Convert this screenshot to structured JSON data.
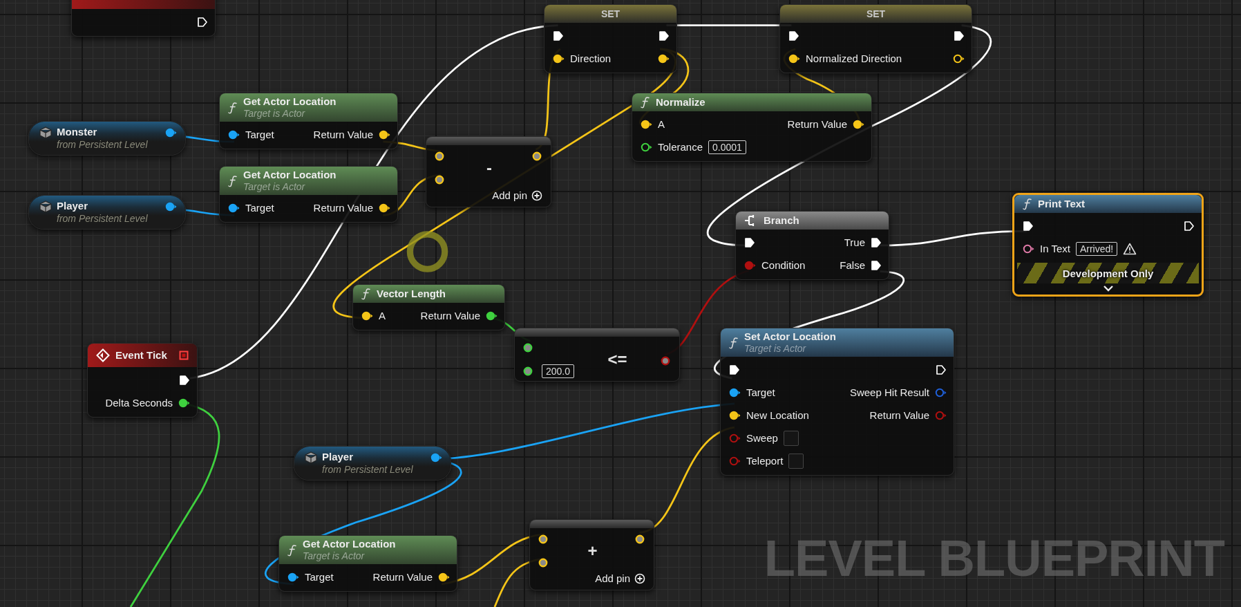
{
  "nodes": [
    {
      "kind": "event",
      "selected": false,
      "outputs": [
        {
          "kind": "exec",
          "connected": false
        }
      ]
    },
    {
      "kind": "set",
      "title": "SET",
      "selected": false,
      "inputs": [
        {
          "kind": "exec",
          "connected": true
        },
        {
          "kind": "vector",
          "label": "Direction",
          "connected": true
        }
      ],
      "outputs": [
        {
          "kind": "exec",
          "connected": true
        },
        {
          "kind": "vector",
          "connected": true
        }
      ]
    },
    {
      "kind": "set",
      "title": "SET",
      "selected": false,
      "inputs": [
        {
          "kind": "exec",
          "connected": true
        },
        {
          "kind": "vector",
          "label": "Normalized Direction",
          "connected": true
        }
      ],
      "outputs": [
        {
          "kind": "exec",
          "connected": true
        },
        {
          "kind": "vector",
          "connected": false
        }
      ]
    },
    {
      "kind": "variable",
      "title": "Monster",
      "subtitle": "from Persistent Level",
      "selected": false,
      "outputs": [
        {
          "kind": "object",
          "connected": true
        }
      ]
    },
    {
      "kind": "pure",
      "title": "Get Actor Location",
      "subtitle": "Target is Actor",
      "selected": false,
      "inputs": [
        {
          "kind": "object",
          "label": "Target",
          "connected": true
        }
      ],
      "outputs": [
        {
          "kind": "vector",
          "label": "Return Value",
          "connected": true
        }
      ]
    },
    {
      "kind": "pure",
      "title": "Get Actor Location",
      "subtitle": "Target is Actor",
      "selected": false,
      "inputs": [
        {
          "kind": "object",
          "label": "Target",
          "connected": true
        }
      ],
      "outputs": [
        {
          "kind": "vector",
          "label": "Return Value",
          "connected": true
        }
      ]
    },
    {
      "kind": "operator",
      "symbol": "-",
      "footer": "Add pin",
      "selected": false,
      "inputs": [
        {
          "kind": "vector",
          "connected": true
        },
        {
          "kind": "vector",
          "connected": true
        }
      ],
      "outputs": [
        {
          "kind": "vector",
          "connected": true
        }
      ]
    },
    {
      "kind": "variable",
      "title": "Player",
      "subtitle": "from Persistent Level",
      "selected": false,
      "outputs": [
        {
          "kind": "object",
          "connected": true
        }
      ]
    },
    {
      "kind": "pure",
      "title": "Normalize",
      "selected": false,
      "inputs": [
        {
          "kind": "vector",
          "label": "A",
          "connected": true
        },
        {
          "kind": "float",
          "label": "Tolerance",
          "connected": false,
          "value": "0.0001"
        }
      ],
      "outputs": [
        {
          "kind": "vector",
          "label": "Return Value",
          "connected": true
        }
      ]
    },
    {
      "kind": "branch",
      "title": "Branch",
      "selected": false,
      "inputs": [
        {
          "kind": "exec",
          "connected": true
        },
        {
          "kind": "bool",
          "label": "Condition",
          "connected": true
        }
      ],
      "outputs": [
        {
          "kind": "exec",
          "label": "True",
          "connected": true
        },
        {
          "kind": "exec",
          "label": "False",
          "connected": true
        }
      ]
    },
    {
      "kind": "function",
      "title": "Print Text",
      "selected": true,
      "inputs": [
        {
          "kind": "exec",
          "connected": true
        },
        {
          "kind": "text",
          "label": "In Text",
          "connected": false,
          "value": "Arrived!",
          "warning": true
        }
      ],
      "outputs": [
        {
          "kind": "exec",
          "connected": false
        }
      ],
      "banner": "Development Only"
    },
    {
      "kind": "pure",
      "title": "Vector Length",
      "selected": false,
      "inputs": [
        {
          "kind": "vector",
          "label": "A",
          "connected": true
        }
      ],
      "outputs": [
        {
          "kind": "float",
          "label": "Return Value",
          "connected": true
        }
      ]
    },
    {
      "kind": "event",
      "title": "Event Tick",
      "selected": false,
      "outputs": [
        {
          "kind": "exec",
          "connected": true
        },
        {
          "kind": "float",
          "label": "Delta Seconds",
          "connected": true
        }
      ]
    },
    {
      "kind": "operator",
      "symbol": "<=",
      "selected": false,
      "inputs": [
        {
          "kind": "float",
          "connected": true
        },
        {
          "kind": "float",
          "connected": true,
          "value": "200.0"
        }
      ],
      "outputs": [
        {
          "kind": "bool",
          "connected": true
        }
      ]
    },
    {
      "kind": "variable",
      "title": "Player",
      "subtitle": "from Persistent Level",
      "selected": false,
      "outputs": [
        {
          "kind": "object",
          "connected": true
        }
      ]
    },
    {
      "kind": "function",
      "title": "Set Actor Location",
      "subtitle": "Target is Actor",
      "selected": false,
      "inputs": [
        {
          "kind": "exec",
          "connected": true
        },
        {
          "kind": "object",
          "label": "Target",
          "connected": true
        },
        {
          "kind": "vector",
          "label": "New Location",
          "connected": true
        },
        {
          "kind": "bool",
          "label": "Sweep",
          "connected": false,
          "checked": false
        },
        {
          "kind": "bool",
          "label": "Teleport",
          "connected": false,
          "checked": false
        }
      ],
      "outputs": [
        {
          "kind": "exec",
          "connected": false
        },
        {
          "kind": "struct",
          "label": "Sweep Hit Result",
          "connected": false
        },
        {
          "kind": "bool",
          "label": "Return Value",
          "connected": false
        }
      ]
    },
    {
      "kind": "pure",
      "title": "Get Actor Location",
      "subtitle": "Target is Actor",
      "selected": false,
      "inputs": [
        {
          "kind": "object",
          "label": "Target",
          "connected": true
        }
      ],
      "outputs": [
        {
          "kind": "vector",
          "label": "Return Value",
          "connected": true
        }
      ]
    },
    {
      "kind": "operator",
      "symbol": "+",
      "footer": "Add pin",
      "selected": false,
      "inputs": [
        {
          "kind": "vector",
          "connected": true
        },
        {
          "kind": "vector",
          "connected": true
        }
      ],
      "outputs": [
        {
          "kind": "vector",
          "connected": true
        }
      ]
    }
  ],
  "overlay_caption": "LEVEL BLUEPRINT"
}
